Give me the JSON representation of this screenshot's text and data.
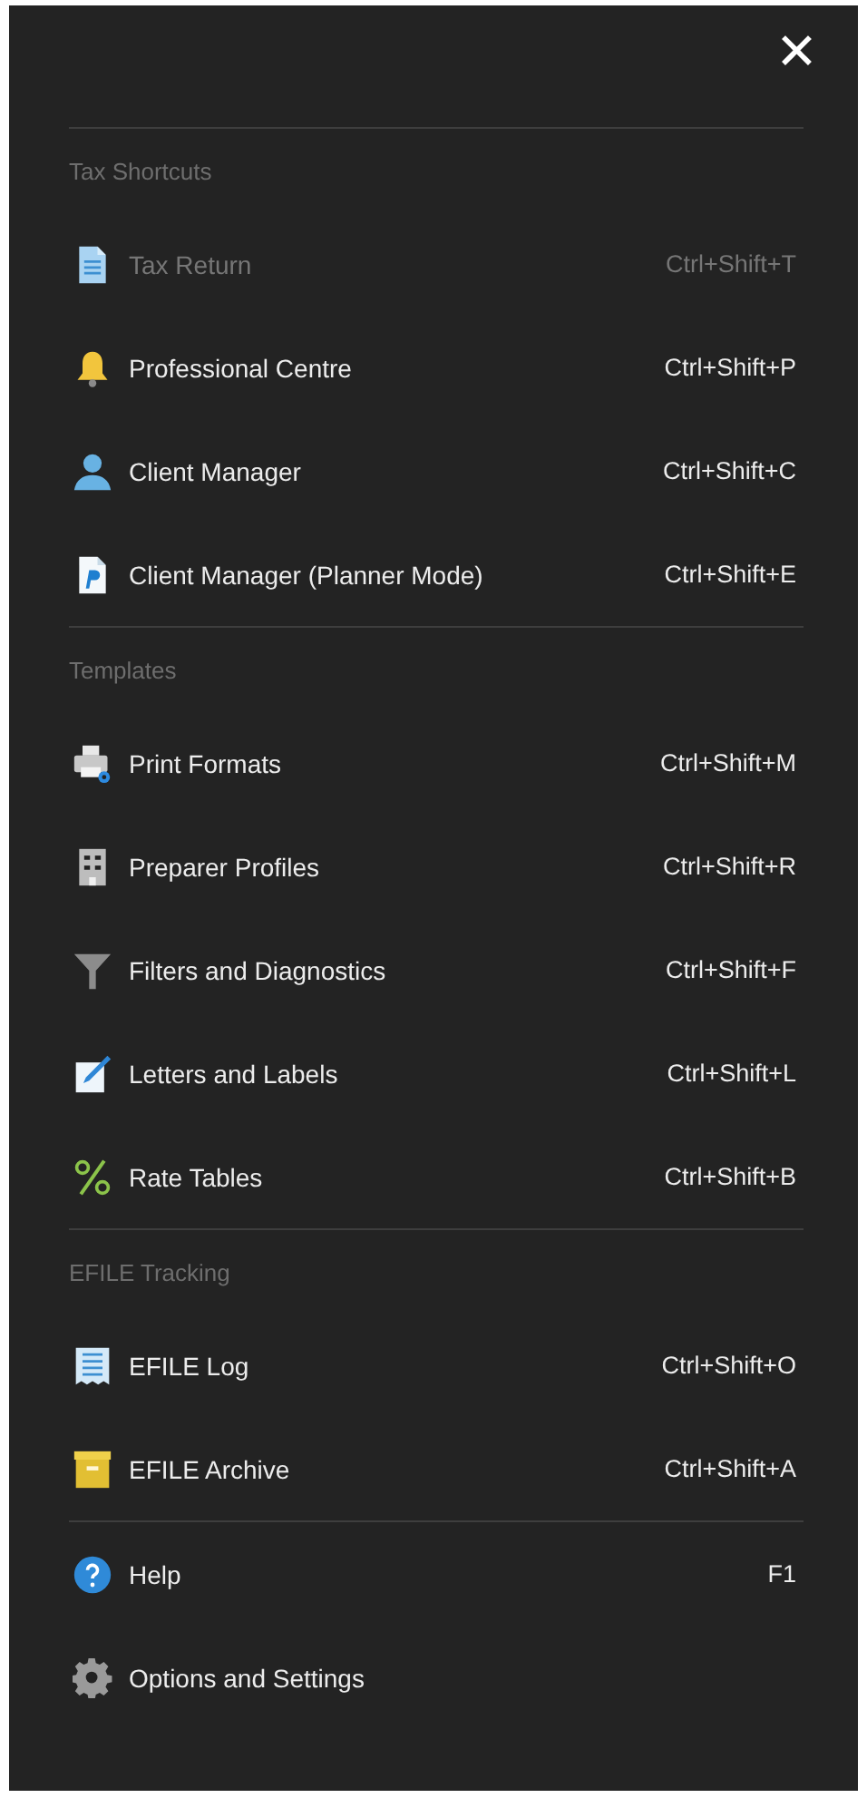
{
  "close_button": {
    "label": "✕"
  },
  "sections": [
    {
      "title": "Tax Shortcuts",
      "items": [
        {
          "kind": "document",
          "label": "Tax Return",
          "shortcut": "Ctrl+Shift+T",
          "disabled": true
        },
        {
          "kind": "bell",
          "label": "Professional Centre",
          "shortcut": "Ctrl+Shift+P",
          "disabled": false
        },
        {
          "kind": "person",
          "label": "Client Manager",
          "shortcut": "Ctrl+Shift+C",
          "disabled": false
        },
        {
          "kind": "planner",
          "label": "Client Manager (Planner Mode)",
          "shortcut": "Ctrl+Shift+E",
          "disabled": false
        }
      ]
    },
    {
      "title": "Templates",
      "items": [
        {
          "kind": "printer",
          "label": "Print Formats",
          "shortcut": "Ctrl+Shift+M",
          "disabled": false
        },
        {
          "kind": "building",
          "label": "Preparer Profiles",
          "shortcut": "Ctrl+Shift+R",
          "disabled": false
        },
        {
          "kind": "funnel",
          "label": "Filters and Diagnostics",
          "shortcut": "Ctrl+Shift+F",
          "disabled": false
        },
        {
          "kind": "pencil",
          "label": "Letters and Labels",
          "shortcut": "Ctrl+Shift+L",
          "disabled": false
        },
        {
          "kind": "percent",
          "label": "Rate Tables",
          "shortcut": "Ctrl+Shift+B",
          "disabled": false
        }
      ]
    },
    {
      "title": "EFILE Tracking",
      "items": [
        {
          "kind": "receipt",
          "label": "EFILE Log",
          "shortcut": "Ctrl+Shift+O",
          "disabled": false
        },
        {
          "kind": "archive",
          "label": "EFILE Archive",
          "shortcut": "Ctrl+Shift+A",
          "disabled": false
        }
      ]
    },
    {
      "items": [
        {
          "kind": "help",
          "label": "Help",
          "shortcut": "F1",
          "disabled": false
        },
        {
          "kind": "gear",
          "label": "Options and Settings",
          "disabled": false
        }
      ]
    }
  ]
}
